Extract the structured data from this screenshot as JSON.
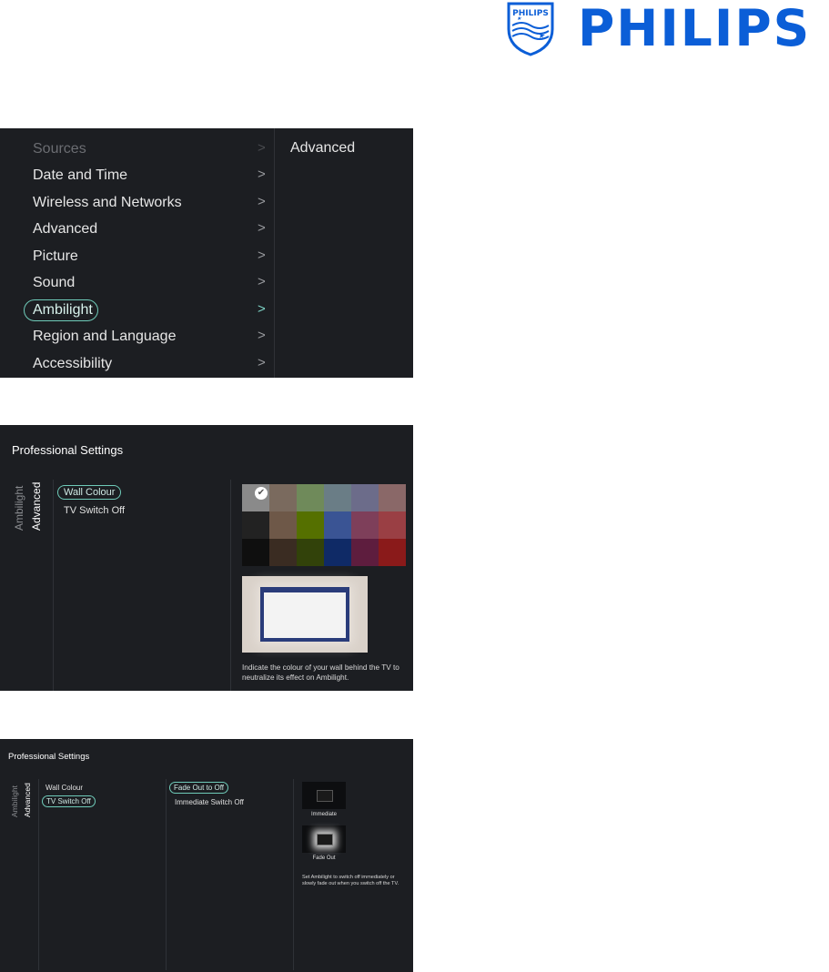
{
  "brand": {
    "logo_text": "PHILIPS",
    "shield_text": "PHILIPS",
    "color": "#0b5ed7"
  },
  "panel1": {
    "menu": [
      {
        "label": "Sources",
        "state": "dimmed"
      },
      {
        "label": "Date and Time",
        "state": "normal"
      },
      {
        "label": "Wireless and Networks",
        "state": "normal"
      },
      {
        "label": "Advanced",
        "state": "normal"
      },
      {
        "label": "Picture",
        "state": "normal"
      },
      {
        "label": "Sound",
        "state": "normal"
      },
      {
        "label": "Ambilight",
        "state": "selected"
      },
      {
        "label": "Region and Language",
        "state": "normal"
      },
      {
        "label": "Accessibility",
        "state": "normal"
      }
    ],
    "submenu": [
      "Advanced"
    ],
    "chevron_icon": "chevron-right-icon",
    "accent": "#6fcbb9"
  },
  "panel2": {
    "title": "Professional Settings",
    "breadcrumb_parent": "Ambilight",
    "breadcrumb_current": "Advanced",
    "options": [
      {
        "label": "Wall Colour",
        "selected": true
      },
      {
        "label": "TV Switch Off",
        "selected": false
      }
    ],
    "swatches": [
      "#8a8a8a",
      "#7a6a5e",
      "#6f8a5a",
      "#6a7d86",
      "#6c6c8a",
      "#8a6868",
      "#222222",
      "#6e5848",
      "#557000",
      "#3a5494",
      "#7e3f5a",
      "#9a3f44",
      "#0f0f0f",
      "#3a2c22",
      "#32420a",
      "#0f2a66",
      "#5e1d3e",
      "#8a1a1a"
    ],
    "selected_swatch_icon": "checkmark-icon",
    "help_text": "Indicate the colour of your wall behind the TV to neutralize its effect on Ambilight."
  },
  "panel3": {
    "title": "Professional Settings",
    "breadcrumb_parent": "Ambilight",
    "breadcrumb_current": "Advanced",
    "options": [
      {
        "label": "Wall Colour",
        "selected": false
      },
      {
        "label": "TV Switch Off",
        "selected": true
      }
    ],
    "suboptions": [
      {
        "label": "Fade Out to Off",
        "selected": true
      },
      {
        "label": "Immediate Switch Off",
        "selected": false
      }
    ],
    "previews": [
      {
        "label": "Immediate"
      },
      {
        "label": "Fade Out"
      }
    ],
    "help_text": "Set Ambilight to switch off immediately or slowly fade out when you switch off the TV."
  }
}
